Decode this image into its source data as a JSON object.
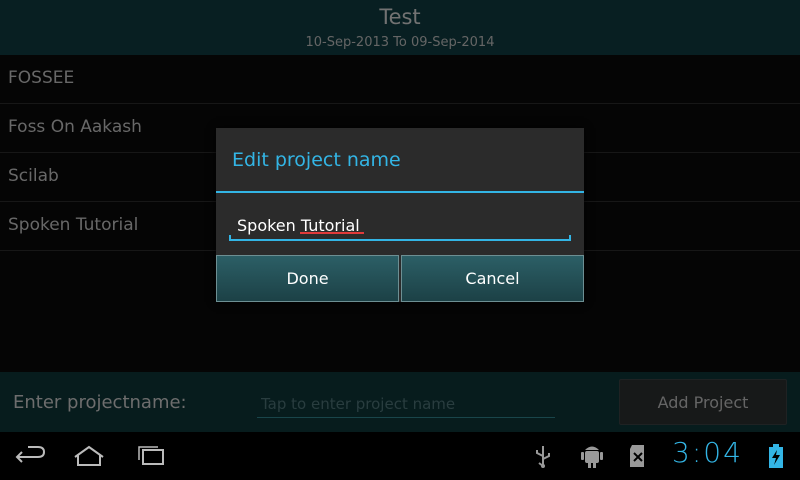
{
  "header": {
    "title": "Test",
    "subtitle": "10-Sep-2013 To 09-Sep-2014"
  },
  "projects": [
    {
      "label": "FOSSEE"
    },
    {
      "label": "Foss On Aakash"
    },
    {
      "label": "Scilab"
    },
    {
      "label": "Spoken Tutorial"
    }
  ],
  "input_bar": {
    "label": "Enter projectname:",
    "placeholder": "Tap to enter project name",
    "add_button": "Add Project"
  },
  "dialog": {
    "title": "Edit project name",
    "value": "Spoken Tutorial",
    "done_label": "Done",
    "cancel_label": "Cancel"
  },
  "status_bar": {
    "time": "3:04",
    "icons": [
      "usb-icon",
      "android-debug-icon",
      "sd-card-icon",
      "battery-charging-icon"
    ]
  },
  "navigation": {
    "icons": [
      "back-icon",
      "home-icon",
      "recent-apps-icon"
    ]
  },
  "colors": {
    "accent": "#33b5e5",
    "header_bg": "#0f3a3e"
  }
}
